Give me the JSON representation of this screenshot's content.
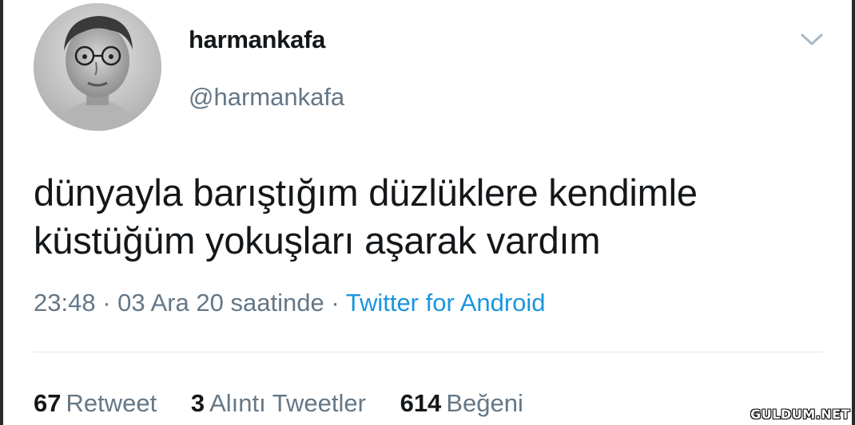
{
  "tweet": {
    "author": {
      "display_name": "harmankafa",
      "handle": "@harmankafa",
      "avatar_icon": "profile-photo"
    },
    "menu_icon": "chevron-down-icon",
    "text_lines": [
      "dünyayla barıştığım düzlüklere kendimle",
      "küstüğüm yokuşları aşarak vardım"
    ],
    "meta": {
      "time": "23:48",
      "separator": "·",
      "date": "03 Ara 20 saatinde",
      "source": "Twitter for Android"
    },
    "stats": [
      {
        "count": "67",
        "label": "Retweet"
      },
      {
        "count": "3",
        "label": "Alıntı Tweetler"
      },
      {
        "count": "614",
        "label": "Beğeni"
      }
    ]
  },
  "watermark": "GULDUM.NET",
  "colors": {
    "text": "#14171a",
    "secondary": "#657786",
    "link": "#1b95e0",
    "divider": "#e1e8ed"
  }
}
